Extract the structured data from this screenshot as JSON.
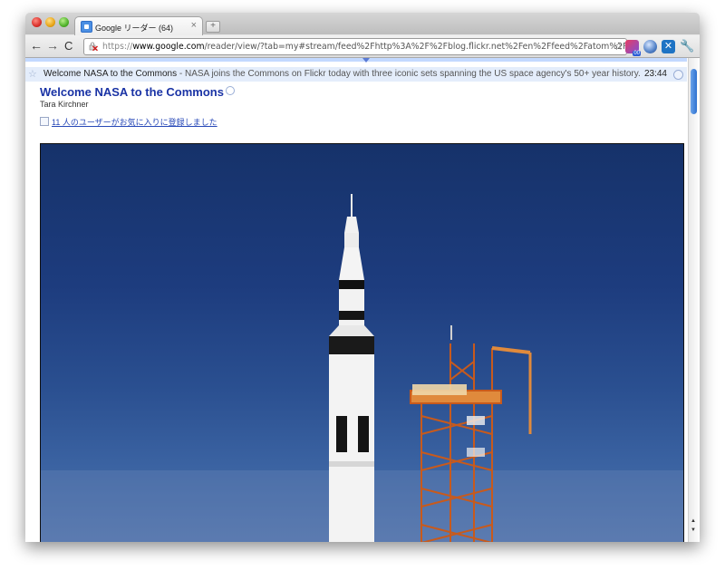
{
  "window": {
    "tab": {
      "title": "Google リーダー (64)",
      "close": "×"
    },
    "new_tab": "+"
  },
  "toolbar": {
    "back": "←",
    "forward": "→",
    "reload": "C",
    "url": {
      "scheme": "https://",
      "host": "www.google.com",
      "path": "/reader/view/?tab=my#stream/feed%2Fhttp%3A%2F%2Fblog.flickr.net%2Fen%2Ffeed%2Fatom%2F"
    },
    "star": "☆",
    "wrench": "🔧",
    "extension_badge": "00"
  },
  "entry": {
    "title": "Welcome NASA to the Commons",
    "snippet": " - NASA joins the Commons on Flickr today with three iconic sets spanning the US space agency's 50+ year history.",
    "time": "23:44",
    "star": "☆"
  },
  "article": {
    "title": "Welcome NASA to the Commons",
    "author": "Tara Kirchner",
    "likes": "11 人のユーザーがお気に入りに登録しました"
  },
  "photo": {
    "subject": "rocket-on-launch-pad"
  },
  "colors": {
    "accent_blue": "#1a33a5",
    "entry_header_bg": "#e4edfb",
    "link": "#2849b8"
  }
}
